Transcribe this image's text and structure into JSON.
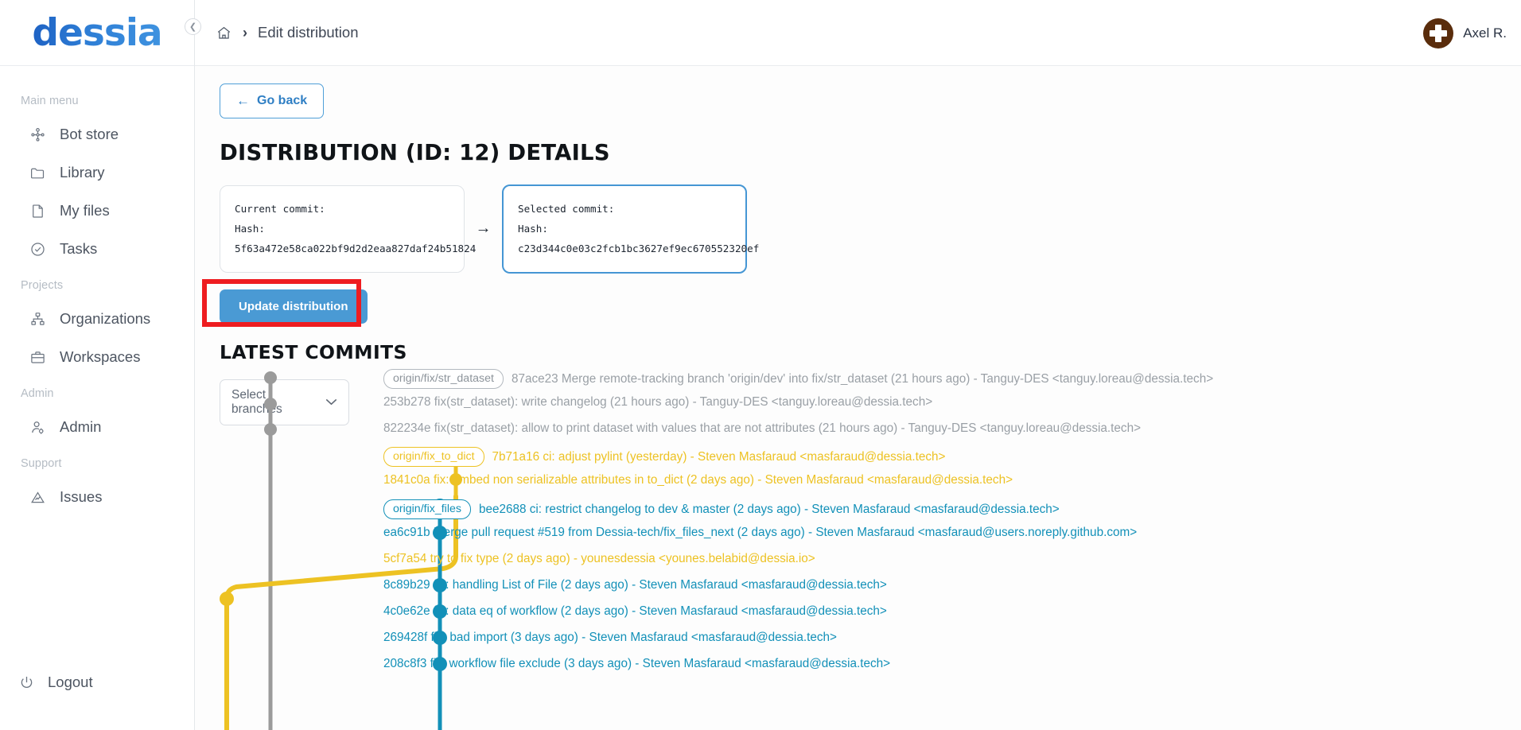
{
  "brand": {
    "logo_text": "dessia"
  },
  "topbar": {
    "collapse_icon": "chevron-left-icon",
    "home_icon": "home-icon",
    "separator": "›",
    "crumb": "Edit distribution",
    "user_name": "Axel R."
  },
  "sidebar": {
    "groups": [
      {
        "label": "Main menu",
        "items": [
          {
            "label": "Bot store",
            "icon": "bot-store-icon"
          },
          {
            "label": "Library",
            "icon": "folder-icon"
          },
          {
            "label": "My files",
            "icon": "file-icon"
          },
          {
            "label": "Tasks",
            "icon": "check-circle-icon"
          }
        ]
      },
      {
        "label": "Projects",
        "items": [
          {
            "label": "Organizations",
            "icon": "organization-icon"
          },
          {
            "label": "Workspaces",
            "icon": "briefcase-icon"
          }
        ]
      },
      {
        "label": "Admin",
        "items": [
          {
            "label": "Admin",
            "icon": "user-cog-icon"
          }
        ]
      },
      {
        "label": "Support",
        "items": [
          {
            "label": "Issues",
            "icon": "warning-triangle-icon"
          }
        ]
      }
    ],
    "logout": {
      "label": "Logout",
      "icon": "power-icon"
    }
  },
  "main": {
    "go_back_label": "Go back",
    "go_back_arrow": "←",
    "page_title": "DISTRIBUTION (ID: 12) DETAILS",
    "current_commit": {
      "title": "Current commit:",
      "hash_line": "Hash: 5f63a472e58ca022bf9d2d2eaa827daf24b51824"
    },
    "arrow": "→",
    "selected_commit": {
      "title": "Selected commit:",
      "hash_line": "Hash: c23d344c0e03c2fcb1bc3627ef9ec670552320ef"
    },
    "update_button_label": "Update distribution",
    "section_title": "LATEST COMMITS",
    "select_branches": {
      "label": "Select branches",
      "chevron": "⌄"
    }
  },
  "colors": {
    "accent_blue": "#4a9ad4",
    "highlight_red": "#ee1c20",
    "graph_gray": "#9b9b9b",
    "graph_yellow": "#edc223",
    "graph_teal": "#1290b8"
  },
  "commits": [
    {
      "ref": "origin/fix/str_dataset",
      "color": "gray",
      "message": "87ace23 Merge remote-tracking branch 'origin/dev' into fix/str_dataset (21 hours ago) - Tanguy-DES <tanguy.loreau@dessia.tech>"
    },
    {
      "ref": "",
      "color": "gray",
      "message": "253b278 fix(str_dataset): write changelog (21 hours ago) - Tanguy-DES <tanguy.loreau@dessia.tech>"
    },
    {
      "ref": "",
      "color": "gray",
      "message": "822234e fix(str_dataset): allow to print dataset with values that are not attributes (21 hours ago) - Tanguy-DES <tanguy.loreau@dessia.tech>"
    },
    {
      "ref": "origin/fix_to_dict",
      "color": "yellow",
      "message": "7b71a16 ci: adjust pylint (yesterday) - Steven Masfaraud <masfaraud@dessia.tech>"
    },
    {
      "ref": "",
      "color": "yellow",
      "message": "1841c0a fix: embed non serializable attributes in to_dict (2 days ago) - Steven Masfaraud <masfaraud@dessia.tech>"
    },
    {
      "ref": "origin/fix_files",
      "color": "teal",
      "message": "bee2688 ci: restrict changelog to dev & master (2 days ago) - Steven Masfaraud <masfaraud@dessia.tech>"
    },
    {
      "ref": "",
      "color": "teal",
      "message": "ea6c91b Merge pull request #519 from Dessia-tech/fix_files_next (2 days ago) - Steven Masfaraud <masfaraud@users.noreply.github.com>"
    },
    {
      "ref": "",
      "color": "yellow",
      "message": "5cf7a54 try to fix type (2 days ago) - younesdessia <younes.belabid@dessia.io>"
    },
    {
      "ref": "",
      "color": "teal",
      "message": "8c89b29 fix: handling List of File (2 days ago) - Steven Masfaraud <masfaraud@dessia.tech>"
    },
    {
      "ref": "",
      "color": "teal",
      "message": "4c0e62e fix: data eq of workflow (2 days ago) - Steven Masfaraud <masfaraud@dessia.tech>"
    },
    {
      "ref": "",
      "color": "teal",
      "message": "269428f fix: bad import (3 days ago) - Steven Masfaraud <masfaraud@dessia.tech>"
    },
    {
      "ref": "",
      "color": "teal",
      "message": "208c8f3 fix: workflow file exclude (3 days ago) - Steven Masfaraud <masfaraud@dessia.tech>"
    }
  ]
}
